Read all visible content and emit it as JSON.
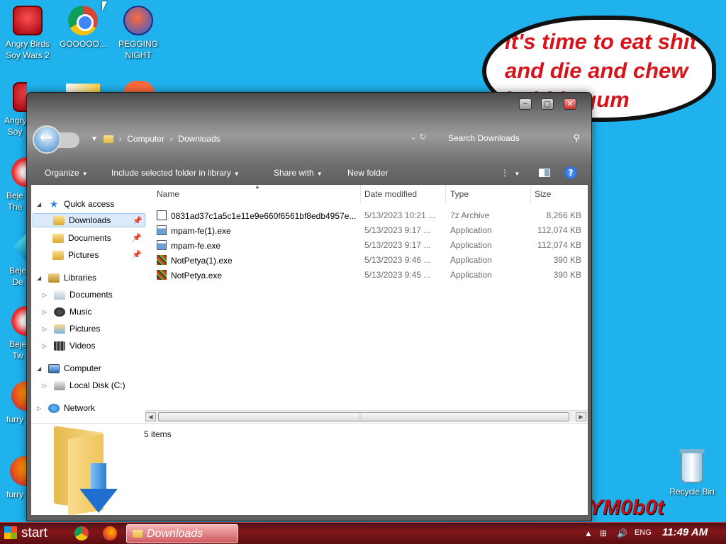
{
  "desktop": {
    "icons": [
      {
        "label": "Angry Birds Soy Wars 2",
        "icon": "angry-birds-icon"
      },
      {
        "label": "GOOOOO...",
        "icon": "chrome-icon"
      },
      {
        "label": "PEGGING NIGHT",
        "icon": "pegging-icon"
      },
      {
        "label": "Angry Soy",
        "icon": "angry-birds-icon"
      },
      {
        "label": "Beje The",
        "icon": "bejeweled-icon"
      },
      {
        "label": "Beje De",
        "icon": "gem-icon"
      },
      {
        "label": "Beje Tw",
        "icon": "bejeweled-icon"
      },
      {
        "label": "furry",
        "icon": "firefox-icon"
      },
      {
        "label": "furry",
        "icon": "firefox-icon"
      }
    ],
    "speech_bubble": "it's time to eat shit and die and chew bubble gum",
    "tag_text": "YM0b0t",
    "recycle_bin": "Recycle Bin"
  },
  "explorer": {
    "breadcrumb": [
      "Computer",
      "Downloads"
    ],
    "search_placeholder": "Search Downloads",
    "toolbar": {
      "organize": "Organize",
      "include": "Include selected folder in library",
      "share": "Share with",
      "new_folder": "New folder"
    },
    "nav": {
      "quick_access": "Quick access",
      "qa_items": [
        "Downloads",
        "Documents",
        "Pictures"
      ],
      "libraries": "Libraries",
      "lib_items": [
        "Documents",
        "Music",
        "Pictures",
        "Videos"
      ],
      "computer": "Computer",
      "local_disk": "Local Disk (C:)",
      "network": "Network"
    },
    "columns": {
      "name": "Name",
      "date": "Date modified",
      "type": "Type",
      "size": "Size"
    },
    "files": [
      {
        "name": "0831ad37c1a5c1e11e9e660f6561bf8edb4957e...",
        "date": "5/13/2023 10:21 ...",
        "type": "7z Archive",
        "size": "8,266 KB",
        "icon": "archive-icon"
      },
      {
        "name": "mpam-fe(1).exe",
        "date": "5/13/2023 9:17 ...",
        "type": "Application",
        "size": "112,074 KB",
        "icon": "app-icon"
      },
      {
        "name": "mpam-fe.exe",
        "date": "5/13/2023 9:17 ...",
        "type": "Application",
        "size": "112,074 KB",
        "icon": "app-icon"
      },
      {
        "name": "NotPetya(1).exe",
        "date": "5/13/2023 9:46 ...",
        "type": "Application",
        "size": "390 KB",
        "icon": "petya-icon"
      },
      {
        "name": "NotPetya.exe",
        "date": "5/13/2023 9:45 ...",
        "type": "Application",
        "size": "390 KB",
        "icon": "petya-icon"
      }
    ],
    "item_count": "5 items"
  },
  "taskbar": {
    "start": "start",
    "active_task": "Downloads",
    "lang": "ENG",
    "clock": "11:49 AM"
  }
}
